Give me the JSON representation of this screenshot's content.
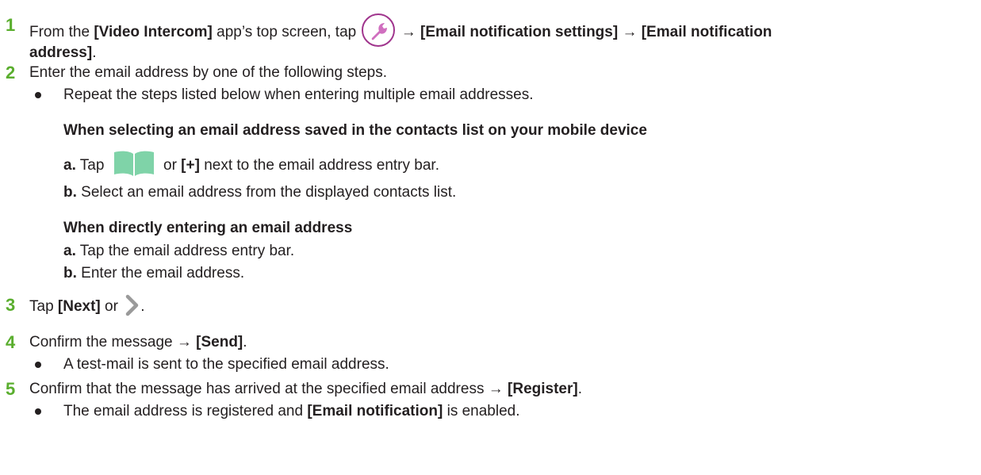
{
  "colors": {
    "step_number": "#5aae2e",
    "wrench_outline": "#a0358d",
    "wrench_fill": "#d06fbf",
    "book_icon": "#7fd3a8",
    "chevron": "#9a9a9a"
  },
  "icons": {
    "wrench": "wrench-icon",
    "book": "contacts-book-icon",
    "chevron": "chevron-right-icon"
  },
  "steps": {
    "s1": {
      "num": "1",
      "t1": "From the ",
      "b1": "[Video Intercom]",
      "t2": " app’s top screen, tap ",
      "arrow1": " → ",
      "b2": "[Email notification settings]",
      "arrow2": " → ",
      "b3": "[Email notification",
      "b4": "address]",
      "t3": "."
    },
    "s2": {
      "num": "2",
      "t1": "Enter the email address by one of the following steps.",
      "bullet1": "Repeat the steps listed below when entering multiple email addresses.",
      "heading1": "When selecting an email address saved in the contacts list on your mobile device",
      "a_label": "a.",
      "a_t1": " Tap ",
      "a_t2": " or ",
      "a_b1": "[+]",
      "a_t3": " next to the email address entry bar.",
      "b_label": "b.",
      "b_t1": " Select an email address from the displayed contacts list.",
      "heading2": "When directly entering an email address",
      "c_label": "a.",
      "c_t1": " Tap the email address entry bar.",
      "d_label": "b.",
      "d_t1": " Enter the email address."
    },
    "s3": {
      "num": "3",
      "t1": "Tap ",
      "b1": "[Next]",
      "t2": " or ",
      "t3": "."
    },
    "s4": {
      "num": "4",
      "t1": "Confirm the message → ",
      "b1": "[Send]",
      "t2": ".",
      "bullet1": "A test-mail is sent to the specified email address."
    },
    "s5": {
      "num": "5",
      "t1": "Confirm that the message has arrived at the specified email address → ",
      "b1": "[Register]",
      "t2": ".",
      "bullet_t1": "The email address is registered and ",
      "bullet_b1": "[Email notification]",
      "bullet_t2": " is enabled."
    }
  }
}
